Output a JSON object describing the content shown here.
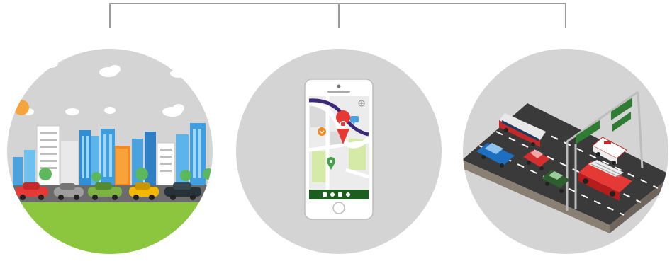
{
  "diagram": {
    "nodes": [
      {
        "id": "city",
        "icon": "city-traffic-icon"
      },
      {
        "id": "navigation",
        "icon": "smartphone-map-icon"
      },
      {
        "id": "highway",
        "icon": "highway-vehicles-icon"
      }
    ]
  },
  "colors": {
    "connector": "#9a9a9a",
    "circle_bg": "#d4d4d4",
    "grass": "#8cc63f",
    "road": "#3a3a3a",
    "pin_red": "#e53935",
    "phone_bar": "#1b5e20"
  }
}
